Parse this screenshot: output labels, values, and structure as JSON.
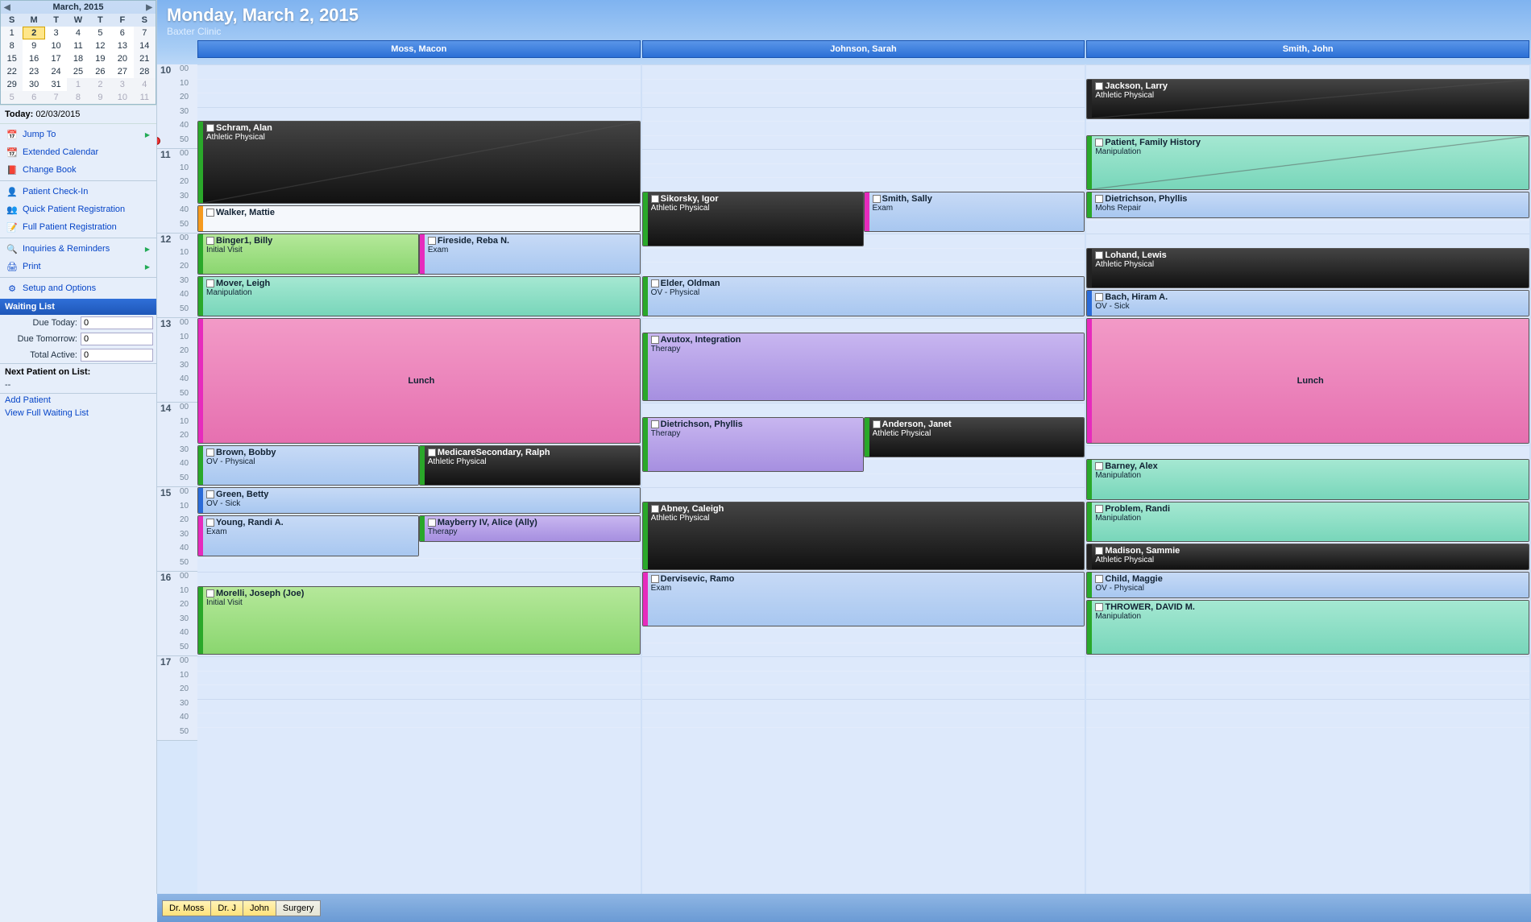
{
  "miniCal": {
    "title": "March, 2015",
    "dow": [
      "S",
      "M",
      "T",
      "W",
      "T",
      "F",
      "S"
    ],
    "cells": [
      {
        "n": 1,
        "wk": true
      },
      {
        "n": 2,
        "sel": true
      },
      {
        "n": 3
      },
      {
        "n": 4
      },
      {
        "n": 5
      },
      {
        "n": 6
      },
      {
        "n": 7,
        "wk": true
      },
      {
        "n": 8,
        "wk": true
      },
      {
        "n": 9
      },
      {
        "n": 10
      },
      {
        "n": 11
      },
      {
        "n": 12
      },
      {
        "n": 13
      },
      {
        "n": 14,
        "wk": true
      },
      {
        "n": 15,
        "wk": true
      },
      {
        "n": 16
      },
      {
        "n": 17
      },
      {
        "n": 18
      },
      {
        "n": 19
      },
      {
        "n": 20
      },
      {
        "n": 21,
        "wk": true
      },
      {
        "n": 22,
        "wk": true
      },
      {
        "n": 23
      },
      {
        "n": 24
      },
      {
        "n": 25
      },
      {
        "n": 26
      },
      {
        "n": 27
      },
      {
        "n": 28,
        "wk": true
      },
      {
        "n": 29,
        "wk": true
      },
      {
        "n": 30
      },
      {
        "n": 31
      },
      {
        "n": 1,
        "dim": true
      },
      {
        "n": 2,
        "dim": true
      },
      {
        "n": 3,
        "dim": true
      },
      {
        "n": 4,
        "dim": true
      },
      {
        "n": 5,
        "dim": true
      },
      {
        "n": 6,
        "dim": true
      },
      {
        "n": 7,
        "dim": true
      },
      {
        "n": 8,
        "dim": true
      },
      {
        "n": 9,
        "dim": true
      },
      {
        "n": 10,
        "dim": true
      },
      {
        "n": 11,
        "dim": true
      }
    ]
  },
  "todayLabel": "Today:",
  "todayDate": "02/03/2015",
  "nav": [
    {
      "icon": "📅",
      "label": "Jump To",
      "chev": true
    },
    {
      "icon": "📆",
      "label": "Extended Calendar"
    },
    {
      "icon": "📕",
      "label": "Change Book"
    },
    {
      "sep": true
    },
    {
      "icon": "👤",
      "label": "Patient Check-In"
    },
    {
      "icon": "👥",
      "label": "Quick Patient Registration"
    },
    {
      "icon": "📝",
      "label": "Full Patient Registration"
    },
    {
      "sep": true
    },
    {
      "icon": "🔍",
      "label": "Inquiries & Reminders",
      "chev": true
    },
    {
      "icon": "🖨",
      "label": "Print",
      "chev": true
    },
    {
      "sep": true
    },
    {
      "icon": "⚙",
      "label": "Setup and Options"
    }
  ],
  "waitingList": {
    "header": "Waiting List",
    "rows": [
      {
        "l": "Due Today:",
        "v": "0"
      },
      {
        "l": "Due Tomorrow:",
        "v": "0"
      },
      {
        "l": "Total Active:",
        "v": "0"
      }
    ],
    "nextLabel": "Next Patient on List:",
    "nextValue": "--",
    "links": [
      "Add Patient",
      "View Full Waiting List"
    ]
  },
  "pageTitle": "Monday, March 2, 2015",
  "clinic": "Baxter Clinic",
  "providers": [
    "Moss, Macon",
    "Johnson, Sarah",
    "Smith, John"
  ],
  "hourStart": 10,
  "hourEnd": 17,
  "pxPerHour": 105,
  "nowOffset": 95,
  "appointments": {
    "0": [
      {
        "t": "10:40",
        "d": 60,
        "name": "Schram, Alan",
        "type": "Athletic Physical",
        "c": "c-black",
        "b": "b-green",
        "cancel": true
      },
      {
        "t": "11:40",
        "d": 20,
        "name": "Walker, Mattie",
        "type": "",
        "c": "c-white",
        "b": "b-orange"
      },
      {
        "t": "12:00",
        "d": 30,
        "name": "Binger1, Billy",
        "type": "Initial Visit",
        "c": "c-green",
        "b": "b-green",
        "w": "50%",
        "left": "0%"
      },
      {
        "t": "12:00",
        "d": 30,
        "name": "Fireside, Reba N.",
        "type": "Exam",
        "c": "c-blue",
        "b": "b-magenta",
        "w": "50%",
        "left": "50%"
      },
      {
        "t": "12:30",
        "d": 30,
        "name": "Mover, Leigh",
        "type": "Manipulation",
        "c": "c-teal",
        "b": "b-green"
      },
      {
        "t": "13:00",
        "d": 90,
        "name": "",
        "type": "Lunch",
        "c": "c-pink",
        "b": "b-magenta",
        "center": true
      },
      {
        "t": "14:30",
        "d": 30,
        "name": "Brown, Bobby",
        "type": "OV - Physical",
        "c": "c-blue",
        "b": "b-green",
        "w": "50%",
        "left": "0%"
      },
      {
        "t": "14:30",
        "d": 30,
        "name": "MedicareSecondary, Ralph",
        "type": "Athletic Physical",
        "c": "c-black",
        "b": "b-green",
        "w": "50%",
        "left": "50%"
      },
      {
        "t": "15:00",
        "d": 20,
        "name": "Green, Betty",
        "type": "OV - Sick",
        "c": "c-blue",
        "b": "b-blue"
      },
      {
        "t": "15:20",
        "d": 30,
        "name": "Young, Randi A.",
        "type": "Exam",
        "c": "c-blue",
        "b": "b-magenta",
        "w": "50%",
        "left": "0%"
      },
      {
        "t": "15:20",
        "d": 20,
        "name": "Mayberry IV, Alice (Ally)",
        "type": "Therapy",
        "c": "c-purple",
        "b": "b-green",
        "w": "50%",
        "left": "50%"
      },
      {
        "t": "16:10",
        "d": 50,
        "name": "Morelli, Joseph (Joe)",
        "type": "Initial Visit",
        "c": "c-green",
        "b": "b-green"
      }
    ],
    "1": [
      {
        "t": "11:30",
        "d": 40,
        "name": "Sikorsky, Igor",
        "type": "Athletic Physical",
        "c": "c-black",
        "b": "b-green",
        "w": "50%",
        "left": "0%"
      },
      {
        "t": "11:30",
        "d": 30,
        "name": "Smith, Sally",
        "type": "Exam",
        "c": "c-blue",
        "b": "b-magenta",
        "w": "50%",
        "left": "50%"
      },
      {
        "t": "12:30",
        "d": 30,
        "name": "Elder, Oldman",
        "type": "OV - Physical",
        "c": "c-blue",
        "b": "b-green"
      },
      {
        "t": "13:10",
        "d": 50,
        "name": "Avutox, Integration",
        "type": "Therapy",
        "c": "c-purple",
        "b": "b-green"
      },
      {
        "t": "14:10",
        "d": 40,
        "name": "Dietrichson, Phyllis",
        "type": "Therapy",
        "c": "c-purple",
        "b": "b-green",
        "w": "50%",
        "left": "0%"
      },
      {
        "t": "14:10",
        "d": 30,
        "name": "Anderson, Janet",
        "type": "Athletic Physical",
        "c": "c-black",
        "b": "b-green",
        "w": "50%",
        "left": "50%"
      },
      {
        "t": "15:10",
        "d": 50,
        "name": "Abney, Caleigh",
        "type": "Athletic Physical",
        "c": "c-black",
        "b": "b-green"
      },
      {
        "t": "16:00",
        "d": 40,
        "name": "Dervisevic, Ramo",
        "type": "Exam",
        "c": "c-blue",
        "b": "b-magenta"
      }
    ],
    "2": [
      {
        "t": "10:10",
        "d": 30,
        "name": "Jackson, Larry",
        "type": "Athletic Physical",
        "c": "c-black",
        "b": "b-dark",
        "cancel": true
      },
      {
        "t": "10:50",
        "d": 40,
        "name": "Patient, Family History",
        "type": "Manipulation",
        "c": "c-teal",
        "b": "b-green",
        "cancel": true
      },
      {
        "t": "11:30",
        "d": 20,
        "name": "Dietrichson, Phyllis",
        "type": "Mohs Repair",
        "c": "c-blue",
        "b": "b-green"
      },
      {
        "t": "12:10",
        "d": 30,
        "name": "Lohand, Lewis",
        "type": "Athletic Physical",
        "c": "c-black",
        "b": "b-dark"
      },
      {
        "t": "12:40",
        "d": 20,
        "name": "Bach, Hiram A.",
        "type": "OV - Sick",
        "c": "c-blue",
        "b": "b-blue"
      },
      {
        "t": "13:00",
        "d": 90,
        "name": "",
        "type": "Lunch",
        "c": "c-pink",
        "b": "b-magenta",
        "center": true
      },
      {
        "t": "14:40",
        "d": 30,
        "name": "Barney, Alex",
        "type": "Manipulation",
        "c": "c-teal",
        "b": "b-green"
      },
      {
        "t": "15:10",
        "d": 30,
        "name": "Problem, Randi",
        "type": "Manipulation",
        "c": "c-teal",
        "b": "b-green"
      },
      {
        "t": "15:40",
        "d": 20,
        "name": "Madison, Sammie",
        "type": "Athletic Physical",
        "c": "c-black",
        "b": "b-dark"
      },
      {
        "t": "16:00",
        "d": 20,
        "name": "Child, Maggie",
        "type": "OV - Physical",
        "c": "c-blue",
        "b": "b-green"
      },
      {
        "t": "16:20",
        "d": 40,
        "name": "THROWER, DAVID M.",
        "type": "Manipulation",
        "c": "c-teal",
        "b": "b-green"
      }
    ]
  },
  "bottomTabs": [
    {
      "l": "Dr. Moss",
      "sel": true
    },
    {
      "l": "Dr. J",
      "sel": true
    },
    {
      "l": "John",
      "sel": true
    },
    {
      "l": "Surgery",
      "sel": false
    }
  ]
}
